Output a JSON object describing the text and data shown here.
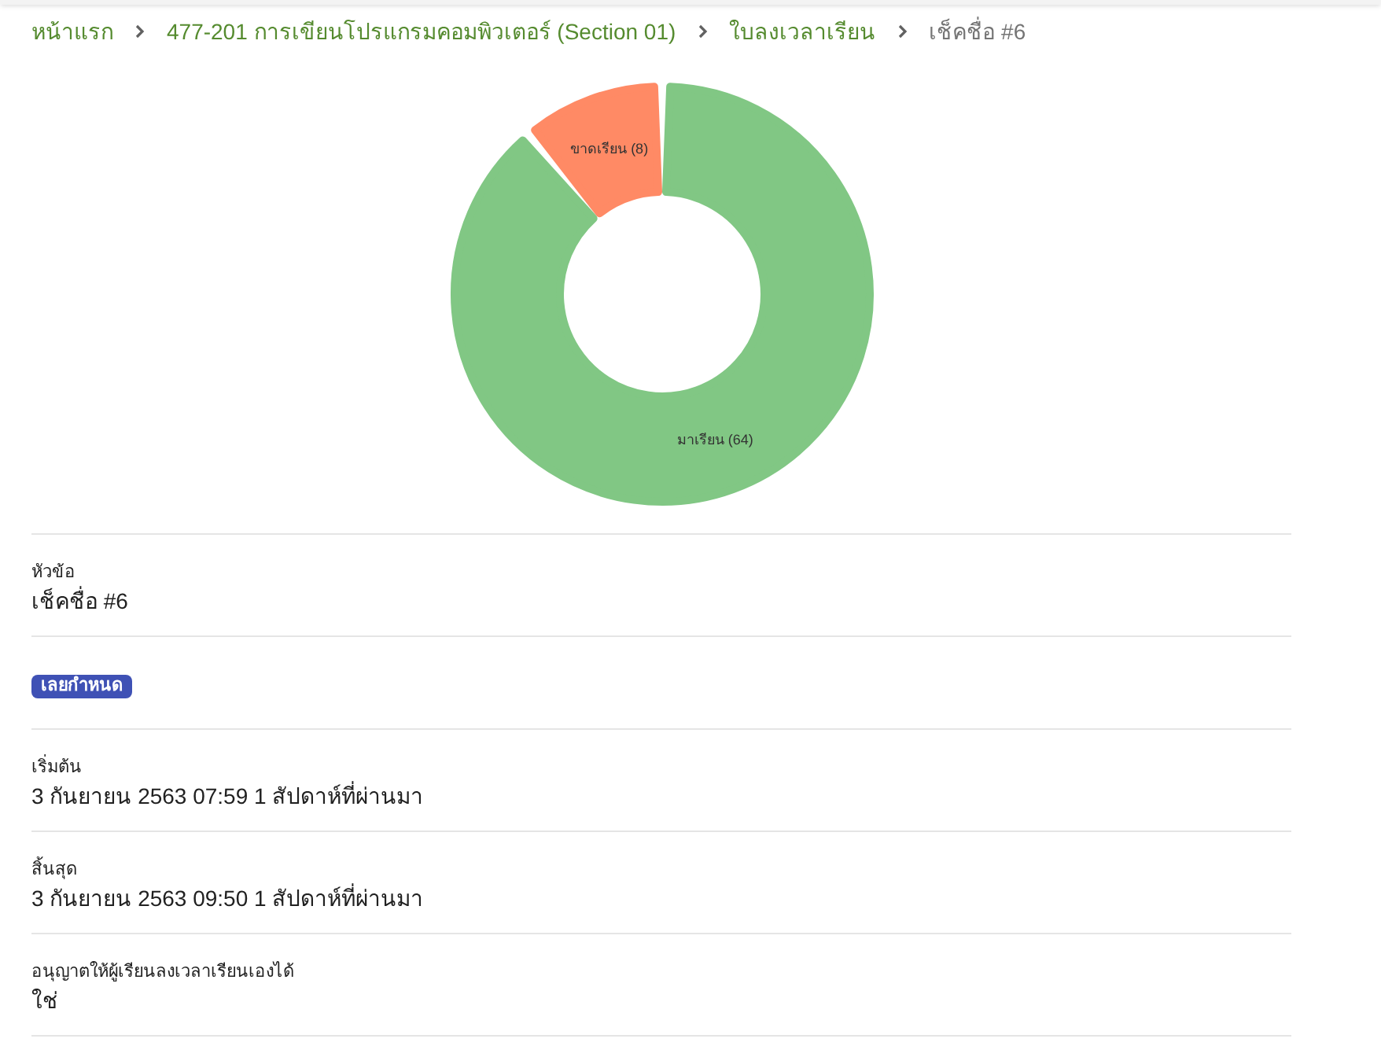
{
  "breadcrumb": [
    {
      "label": "หน้าแรก",
      "current": false
    },
    {
      "label": "477-201 การเขียนโปรแกรมคอมพิวเตอร์ (Section 01)",
      "current": false
    },
    {
      "label": "ใบลงเวลาเรียน",
      "current": false
    },
    {
      "label": "เช็คชื่อ #6",
      "current": true
    }
  ],
  "chart_data": {
    "type": "donut",
    "categories": [
      "มาเรียน (64)",
      "ขาดเรียน (8)"
    ],
    "values": [
      64,
      8
    ],
    "colors": [
      "#81c784",
      "#ff8a65"
    ]
  },
  "details": [
    {
      "kind": "field",
      "label": "หัวข้อ",
      "value": "เช็คชื่อ #6"
    },
    {
      "kind": "badge",
      "text": "เลยกำหนด"
    },
    {
      "kind": "field",
      "label": "เริ่มต้น",
      "value": "3 กันยายน 2563 07:59 1 สัปดาห์ที่ผ่านมา"
    },
    {
      "kind": "field",
      "label": "สิ้นสุด",
      "value": "3 กันยายน 2563 09:50 1 สัปดาห์ที่ผ่านมา"
    },
    {
      "kind": "field",
      "label": "อนุญาตให้ผู้เรียนลงเวลาเรียนเองได้",
      "value": "ใช่"
    }
  ]
}
